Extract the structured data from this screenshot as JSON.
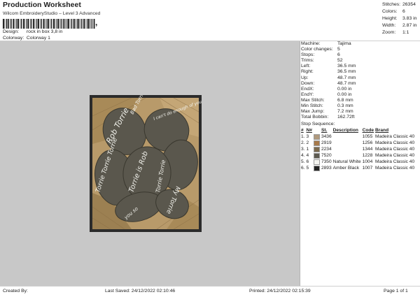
{
  "header": {
    "title": "Production Worksheet",
    "subtitle": "Wilcom EmbroideryStudio – Level 3 Advanced",
    "design_label": "Design:",
    "design_value": "rock in box 3,8 in",
    "colorway_label": "Colorway:",
    "colorway_value": "Colorway 1"
  },
  "stats": [
    {
      "label": "Stitches:",
      "value": "26354"
    },
    {
      "label": "Colors:",
      "value": "6"
    },
    {
      "label": "Height:",
      "value": "3.83 in"
    },
    {
      "label": "Width:",
      "value": "2.87 in"
    },
    {
      "label": "Zoom:",
      "value": "1:1"
    }
  ],
  "machine_info": [
    {
      "label": "Machine:",
      "value": "Tajima"
    },
    {
      "label": "Color changes:",
      "value": "5"
    },
    {
      "label": "Stops:",
      "value": "6"
    },
    {
      "label": "Trims:",
      "value": "52"
    },
    {
      "label": "Left:",
      "value": "36.5 mm"
    },
    {
      "label": "Right:",
      "value": "36.5 mm"
    },
    {
      "label": "Up:",
      "value": "48.7 mm"
    },
    {
      "label": "Down:",
      "value": "48.7 mm"
    },
    {
      "label": "EndX:",
      "value": "0.00 in"
    },
    {
      "label": "EndY:",
      "value": "0.00 in"
    },
    {
      "label": "Max Stitch:",
      "value": "6.8 mm"
    },
    {
      "label": "Min Stitch:",
      "value": "0.3 mm"
    },
    {
      "label": "Max Jump:",
      "value": "7.2 mm"
    },
    {
      "label": "Total Bobbin:",
      "value": "162.72ft"
    }
  ],
  "stop_sequence": {
    "title": "Stop Sequence:",
    "columns": [
      "#",
      "N#",
      "St.",
      "Description",
      "Code",
      "Brand"
    ],
    "rows": [
      {
        "num": "1.",
        "n": "3",
        "color": "#b09a7e",
        "st": "3436",
        "desc": "",
        "code": "1055",
        "brand": "Madeira Classic 40"
      },
      {
        "num": "2.",
        "n": "2",
        "color": "#a87a4a",
        "st": "2919",
        "desc": "",
        "code": "1256",
        "brand": "Madeira Classic 40"
      },
      {
        "num": "3.",
        "n": "1",
        "color": "#7b6a4e",
        "st": "2234",
        "desc": "",
        "code": "1344",
        "brand": "Madeira Classic 40"
      },
      {
        "num": "4.",
        "n": "4",
        "color": "#5d5a50",
        "st": "7520",
        "desc": "",
        "code": "1228",
        "brand": "Madeira Classic 40"
      },
      {
        "num": "5.",
        "n": "6",
        "color": "#f4f4f0",
        "st": "7350",
        "desc": "Natural White",
        "code": "1004",
        "brand": "Madeira Classic 40"
      },
      {
        "num": "6.",
        "n": "5",
        "color": "#222222",
        "st": "2893",
        "desc": "Amber Black",
        "code": "1007",
        "brand": "Madeira Classic 40"
      }
    ]
  },
  "footer": {
    "created_by": "Created By:",
    "last_saved": "Last Saved: 24/12/2022 02:10:46",
    "printed": "Printed: 24/12/2022 02:15:39",
    "page": "Page 1 of 1"
  },
  "design_texts": [
    "Rob Torrie",
    "Bad Torrie",
    "I can't do enough of your love",
    "Torrie Torrie Torrie",
    "Torrie is Rob",
    "Torrie Torrie",
    "My Torrie",
    "you so"
  ]
}
